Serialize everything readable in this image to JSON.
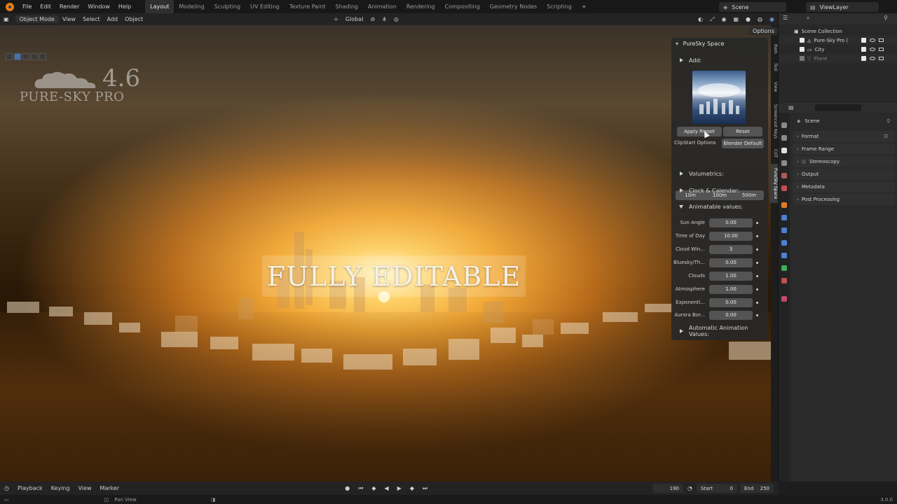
{
  "topbar": {
    "menus": [
      "File",
      "Edit",
      "Render",
      "Window",
      "Help"
    ],
    "workspaces": [
      "Layout",
      "Modeling",
      "Sculpting",
      "UV Editing",
      "Texture Paint",
      "Shading",
      "Animation",
      "Rendering",
      "Compositing",
      "Geometry Nodes",
      "Scripting"
    ],
    "active_workspace": "Layout",
    "scene_field": "Scene",
    "view_layer_field": "ViewLayer"
  },
  "viewport_header": {
    "mode": "Object Mode",
    "menus": [
      "View",
      "Select",
      "Add",
      "Object"
    ],
    "orientation": "Global",
    "options_label": "Options"
  },
  "logo": {
    "version": "4.6",
    "name": "PURE-SKY PRO"
  },
  "overlay_title": "FULLY EDITABLE",
  "panel": {
    "title": "PureSky Space",
    "add_label": "Add:",
    "apply_preset": "Apply Preset",
    "reset": "Reset",
    "clipstart_label": "ClipStart Options",
    "clipstart_value": "Blender Default",
    "distances": [
      "10m",
      "100m",
      "500m"
    ],
    "sections": {
      "volumetrics": "Volumetrics:",
      "clock": "Clock & Calendar:",
      "animatable": "Animatable values:",
      "auto_anim": "Automatic Animation Values:"
    },
    "props": [
      {
        "label": "Sun Angle",
        "value": "0.00"
      },
      {
        "label": "Time of Day",
        "value": "10.00"
      },
      {
        "label": "Cloud Win...",
        "value": "3"
      },
      {
        "label": "Bluesky/Th...",
        "value": "0.00"
      },
      {
        "label": "Clouds",
        "value": "1.00"
      },
      {
        "label": "Atmosphere",
        "value": "1.00"
      },
      {
        "label": "Exponenti...",
        "value": "0.00"
      },
      {
        "label": "Aurora Bor...",
        "value": "0.00"
      }
    ]
  },
  "side_tabs": [
    "Item",
    "Tool",
    "View",
    "Screencast Keys",
    "COT",
    "PureSky Space"
  ],
  "outliner": {
    "collection": "Scene Collection",
    "rows": [
      {
        "name": "Pure-Sky Pro ("
      },
      {
        "name": "City"
      },
      {
        "name": "Plane"
      }
    ]
  },
  "properties": {
    "scene_label": "Scene",
    "panels": [
      "Format",
      "Frame Range",
      "Stereoscopy",
      "Output",
      "Metadata",
      "Post Processing"
    ]
  },
  "timeline": {
    "menus": [
      "Playback",
      "Keying",
      "View",
      "Marker"
    ],
    "current_frame": "190",
    "start_label": "Start",
    "start_value": "0",
    "end_label": "End",
    "end_value": "250"
  },
  "status": {
    "hint": "Pan View",
    "version": "3.0.0"
  }
}
